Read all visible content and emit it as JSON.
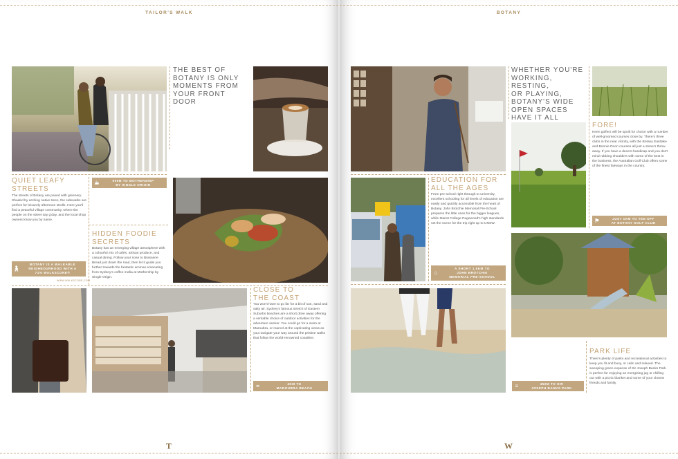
{
  "left_page": {
    "running_head": "TAILOR'S WALK",
    "folio": "T",
    "tagline": {
      "line1": "THE BEST OF",
      "line2": "BOTANY IS ONLY",
      "line3": "MOMENTS FROM",
      "line4": "YOUR FRONT DOOR"
    },
    "streets": {
      "heading1": "QUIET LEAFY",
      "heading2": "STREETS",
      "body": "The streets of Botany are paved with greenery. Shaded by arching native trees, the sidewalks are perfect for leisurely afternoon strolls. Here you'll find a peaceful village community, where the people on the street say g'day, and the local shop owners know you by name.",
      "badge_line1": "BOTANY IS A WALKABLE",
      "badge_line2": "NEIGHBOURHOOD WITH A",
      "badge_line3": "71% WALKSCORE®",
      "source": "WWW.WALKSCORE.COM"
    },
    "coffee_badge": {
      "line1": "900M TO MOTHERSHIP",
      "line2": "BY SINGLE ORIGIN"
    },
    "foodie": {
      "heading1": "HIDDEN FOODIE",
      "heading2": "SECRETS",
      "body": "Botany has an emerging village atmosphere with a colourful mix of cafés, artisan produce, and casual dining. Follow your nose to Brasserie Bread just down the road, then let it guide you further towards the fantastic aromas emanating from Sydney's coffee mafia at Mothership by Single Origin."
    },
    "coast": {
      "heading1": "CLOSE TO",
      "heading2": "THE COAST",
      "body": "You won't have to go far for a bit of sun, sand and salty air. Sydney's famous stretch of Eastern Suburbs beaches are a short drive away offering a veritable choice of outdoor activities for the adventure seeker. You could go for a swim at Maroubra, or marvel at the captivating views as you navigate your way around the pristine walks that follow the world-renowned coastline.",
      "badge_line1": "4KM TO",
      "badge_line2": "MAROUBRA BEACH"
    }
  },
  "right_page": {
    "running_head": "BOTANY",
    "folio": "W",
    "tagline": {
      "line1": "WHETHER YOU'RE",
      "line2": "WORKING, RESTING,",
      "line3": "OR PLAYING,",
      "line4": "BOTANY'S WIDE",
      "line5": "OPEN SPACES",
      "line6": "HAVE IT ALL"
    },
    "fore": {
      "heading": "FORE!",
      "body": "Keen golfers will be spoilt for choice with a number of well-groomed courses close by. There's three clubs in the near vicinity, with the Botany Eastlake and Bonnie Doon courses all just a stone's throw away. If you have a decent handicap and you don't mind rubbing shoulders with some of the best in the business, the Australian Golf Club offers some of the finest fairways in the country.",
      "badge_line1": "JUST 1KM TO TEE-OFF",
      "badge_line2": "AT BOTANY GOLF CLUB"
    },
    "education": {
      "heading1": "EDUCATION FOR",
      "heading2": "ALL THE AGES",
      "body": "From pre-school right through to university, excellent schooling for all levels of education are easily and quickly accessible from the heart of Botany. John Brotchie Memorial Pre-School prepares the little ones for the bigger leagues, while Marist College Pagewood's high standards set the scene for the trip right up to UNSW.",
      "badge_line1": "A SHORT 1.5KM TO",
      "badge_line2": "JOHN BROTCHIE",
      "badge_line3": "MEMORIAL PRE-SCHOOL"
    },
    "park": {
      "heading": "PARK LIFE",
      "body": "There's plenty of parks and recreational activities to keep you fit and busy, or calm and relaxed. The sweeping green expanse of Sir Joseph Banks Park is perfect for enjoying an energising jog or chilling our with a picnic blanket and some of your closest friends and family.",
      "badge_line1": "450M TO SIR",
      "badge_line2": "JOSEPH BANKS PARK"
    }
  },
  "colors": {
    "accent_gold": "#c1a67f",
    "heading_gold": "#c4a274",
    "tagline_grey": "#5e5e5e"
  },
  "icons": [
    "walking-icon",
    "coffee-cup-icon",
    "waves-icon",
    "school-icon",
    "golf-flag-icon",
    "park-bench-icon"
  ]
}
